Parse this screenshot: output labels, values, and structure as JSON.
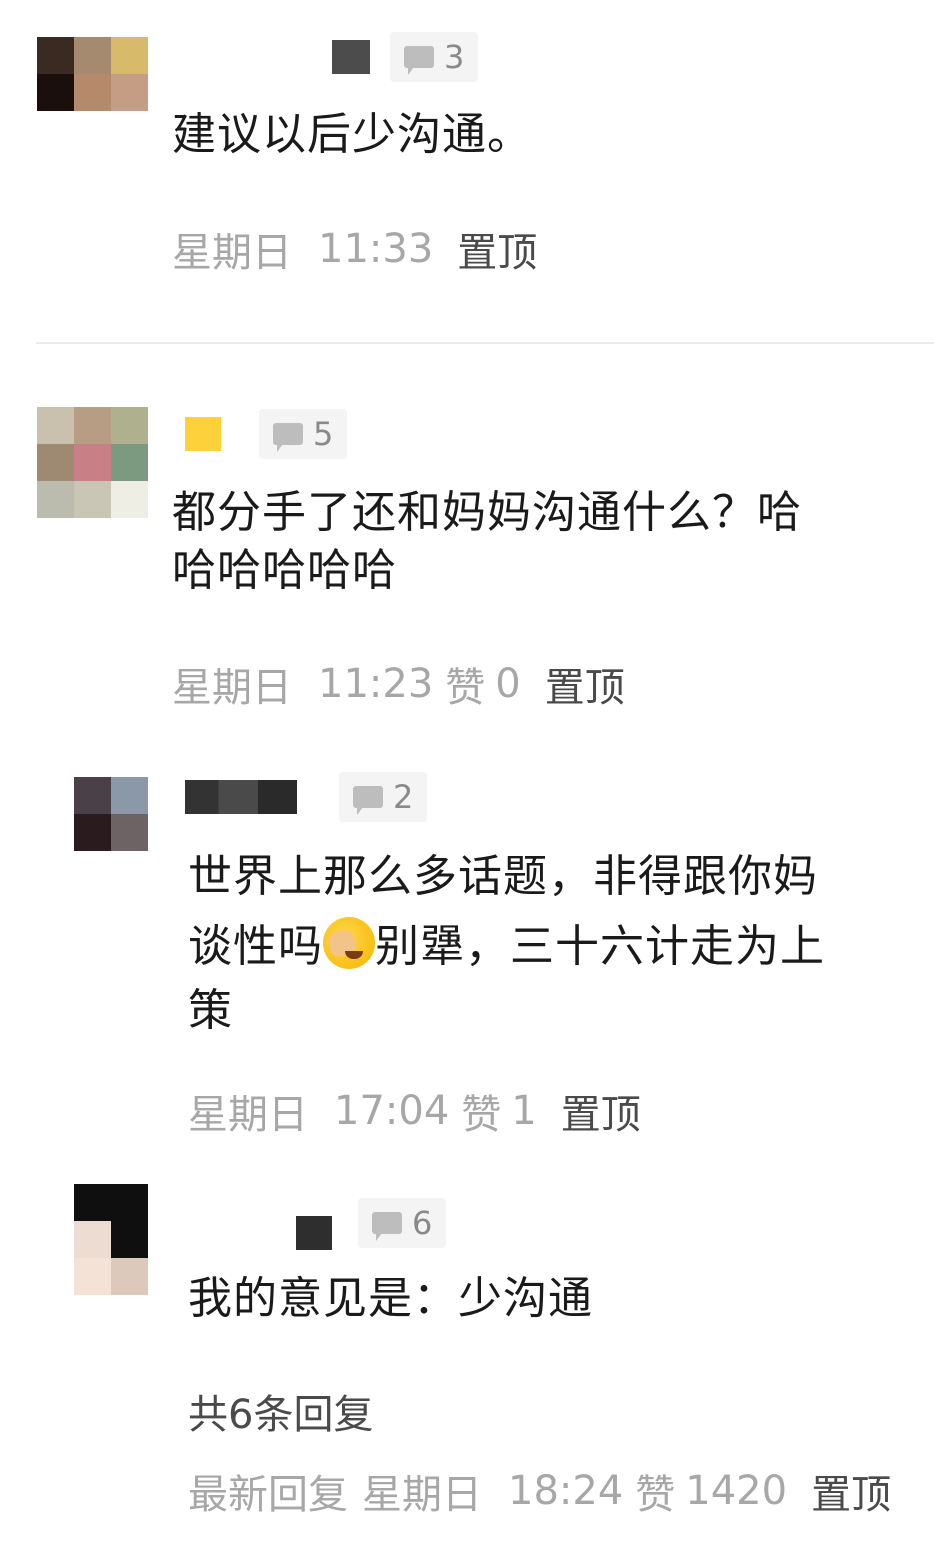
{
  "comments": [
    {
      "reply_count": "3",
      "text": "建议以后少沟通。",
      "day": "星期日",
      "time": "11:33",
      "like_label": "",
      "likes": "",
      "pin": "置顶"
    },
    {
      "reply_count": "5",
      "text_line1": "都分手了还和妈妈沟通什么？哈",
      "text_line2": "哈哈哈哈哈",
      "day": "星期日",
      "time": "11:23",
      "like_label": "赞",
      "likes": "0",
      "pin": "置顶"
    },
    {
      "reply_count": "2",
      "text_line1": "世界上那么多话题，非得跟你妈",
      "text_line2_a": "谈性吗",
      "text_line2_b": "别犟，三十六计走为上",
      "text_line3": "策",
      "emoji": "facepalm-laugh-emoji",
      "day": "星期日",
      "time": "17:04",
      "like_label": "赞",
      "likes": "1",
      "pin": "置顶"
    },
    {
      "reply_count": "6",
      "text": "我的意见是：少沟通",
      "total_replies": "共6条回复",
      "latest_label": "最新回复",
      "day": "星期日",
      "time": "18:24",
      "like_label": "赞",
      "likes": "1420",
      "pin": "置顶"
    }
  ],
  "icons": {
    "reply": "comment-bubble-icon"
  },
  "colors": {
    "meta_gray": "#a7a7a7",
    "pin_dark": "#4a4a4a",
    "text": "#1a1a1a",
    "badge_bg": "#f4f4f4"
  }
}
